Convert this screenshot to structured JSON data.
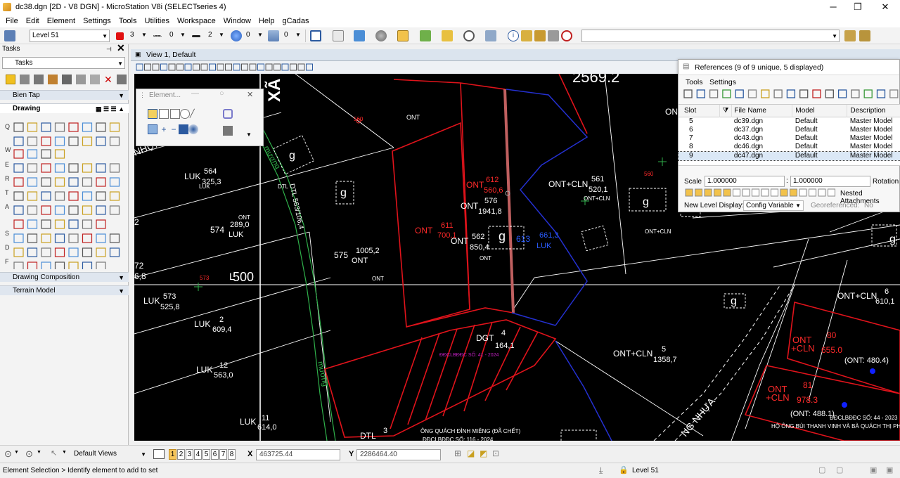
{
  "window": {
    "title": "dc38.dgn [2D - V8 DGN] - MicroStation V8i (SELECTseries 4)",
    "minimize": "─",
    "maximize": "❐",
    "close": "✕"
  },
  "menu": [
    "File",
    "Edit",
    "Element",
    "Settings",
    "Tools",
    "Utilities",
    "Workspace",
    "Window",
    "Help",
    "gCadas"
  ],
  "toolbar": {
    "level": "Level 51",
    "color": "3",
    "style": "0",
    "weight": "2",
    "transparency": "0",
    "priority": "0"
  },
  "tasks": {
    "header": "Tasks",
    "dropdown": "Tasks",
    "sections": [
      {
        "label": "Bien Tap"
      },
      {
        "label": "Drawing"
      },
      {
        "label": "Drawing Composition"
      },
      {
        "label": "Terrain Model"
      }
    ],
    "row_letters": [
      "Q",
      "W",
      "E",
      "R",
      "T",
      "A",
      "S",
      "D",
      "F"
    ]
  },
  "view": {
    "title": "View 1, Default"
  },
  "element_panel": {
    "title": "Element..."
  },
  "references": {
    "title": "References (9 of 9 unique, 5 displayed)",
    "menu": [
      "Tools",
      "Settings"
    ],
    "columns": [
      "Slot",
      "File Name",
      "Model",
      "Description"
    ],
    "rows": [
      {
        "slot": "5",
        "file": "dc39.dgn",
        "model": "Default",
        "desc": "Master Model"
      },
      {
        "slot": "6",
        "file": "dc37.dgn",
        "model": "Default",
        "desc": "Master Model"
      },
      {
        "slot": "7",
        "file": "dc43.dgn",
        "model": "Default",
        "desc": "Master Model"
      },
      {
        "slot": "8",
        "file": "dc46.dgn",
        "model": "Default",
        "desc": "Master Model"
      },
      {
        "slot": "9",
        "file": "dc47.dgn",
        "model": "Default",
        "desc": "Master Model"
      }
    ],
    "scale_label": "Scale",
    "scale_a": "1.000000",
    "scale_b": "1.000000",
    "rotation_label": "Rotation",
    "nested_label": "Nested Attachments",
    "new_level_label": "New Level Display:",
    "new_level_value": "Config Variable",
    "georef_label": "Georeferenced:",
    "georef_value": "No"
  },
  "bottom": {
    "views": "Default Views",
    "view_numbers": [
      "1",
      "2",
      "3",
      "4",
      "5",
      "6",
      "7",
      "8"
    ],
    "x_label": "X",
    "x_value": "463725.44",
    "y_label": "Y",
    "y_value": "2286464.40"
  },
  "status": {
    "message": "Element Selection > Identify element to add to set",
    "level": "Level 51"
  },
  "map_labels": [
    {
      "t": "2569.2"
    },
    {
      "t": "XÃ"
    },
    {
      "t": "ONT"
    },
    {
      "t": "560"
    },
    {
      "t": "g"
    },
    {
      "t": "NHỰA"
    },
    {
      "t": "LUK"
    },
    {
      "t": "564"
    },
    {
      "t": "325,3"
    },
    {
      "t": "LUK"
    },
    {
      "t": "DTL"
    },
    {
      "t": "g"
    },
    {
      "t": "ONT"
    },
    {
      "t": "612"
    },
    {
      "t": "560,6"
    },
    {
      "t": "ONT"
    },
    {
      "t": "576"
    },
    {
      "t": "1941,8"
    },
    {
      "t": "ONT+CLN"
    },
    {
      "t": "561"
    },
    {
      "t": "520,1"
    },
    {
      "t": "ONT+CLN"
    },
    {
      "t": "560"
    },
    {
      "t": "g"
    },
    {
      "t": "ONT"
    },
    {
      "t": "g"
    },
    {
      "t": "ONT+CLN"
    },
    {
      "t": "ONT"
    },
    {
      "t": "611"
    },
    {
      "t": "700,1"
    },
    {
      "t": "ONT"
    },
    {
      "t": "562"
    },
    {
      "t": "850,4"
    },
    {
      "t": "g"
    },
    {
      "t": "ONT"
    },
    {
      "t": "613"
    },
    {
      "t": "661,3"
    },
    {
      "t": "LUK"
    },
    {
      "t": "574"
    },
    {
      "t": "289,0"
    },
    {
      "t": "LUK"
    },
    {
      "t": "ONT"
    },
    {
      "t": "575"
    },
    {
      "t": "1005,2"
    },
    {
      "t": "ONT"
    },
    {
      "t": "ONT"
    },
    {
      "t": "2"
    },
    {
      "t": "72"
    },
    {
      "t": "6,8"
    },
    {
      "t": "573"
    },
    {
      "t": "L"
    },
    {
      "t": "500"
    },
    {
      "t": "LUK"
    },
    {
      "t": "573"
    },
    {
      "t": "525,8"
    },
    {
      "t": "g"
    },
    {
      "t": "ONT+CLN"
    },
    {
      "t": "6"
    },
    {
      "t": "610,1"
    },
    {
      "t": "LUK"
    },
    {
      "t": "2"
    },
    {
      "t": "609,4"
    },
    {
      "t": "DGT"
    },
    {
      "t": "4"
    },
    {
      "t": "164,1"
    },
    {
      "t": "ONT+CLN"
    },
    {
      "t": "5"
    },
    {
      "t": "1358,7"
    },
    {
      "t": "ONT"
    },
    {
      "t": "+CLN"
    },
    {
      "t": "80"
    },
    {
      "t": "655.0"
    },
    {
      "t": "(ONT: 480.4)"
    },
    {
      "t": "LUK"
    },
    {
      "t": "12"
    },
    {
      "t": "563,0"
    },
    {
      "t": "ONT"
    },
    {
      "t": "+CLN"
    },
    {
      "t": "81"
    },
    {
      "t": "978.3"
    },
    {
      "t": "(ONT: 488.1)"
    },
    {
      "t": "LUK"
    },
    {
      "t": "11"
    },
    {
      "t": "614,0"
    },
    {
      "t": "DTL"
    },
    {
      "t": "3"
    },
    {
      "t": "ÔNG QUÁCH ĐÌNH MIÊNG (ĐÃ CHẾT)"
    },
    {
      "t": "ĐĐCLBĐĐC SỐ: 116 - 2024"
    },
    {
      "t": "ĐĐCLBĐĐC SỐ: 44 - 2023"
    },
    {
      "t": "HỘ ÔNG BÙI THANH VINH VÀ BÀ QUÁCH THỊ PHÁ"
    },
    {
      "t": "NG NHỰA"
    },
    {
      "t": "mương"
    },
    {
      "t": "DTL 563/106,4"
    },
    {
      "t": "mương"
    },
    {
      "t": "g"
    },
    {
      "t": "g"
    },
    {
      "t": "ĐĐCLBĐĐC SỐ: 41 - 2024"
    }
  ]
}
